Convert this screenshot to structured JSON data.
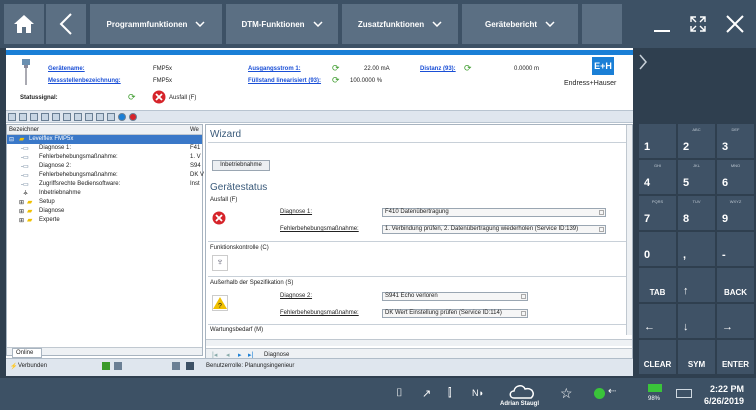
{
  "toolbar": {
    "programm": "Programmfunktionen",
    "dtm": "DTM-Funktionen",
    "zusatz": "Zusatzfunktionen",
    "bericht": "Gerätebericht"
  },
  "header": {
    "geraetename_label": "Gerätename:",
    "geraetename": "FMP5x",
    "messstelle_label": "Messstellenbezeichnung:",
    "messstelle": "FMP5x",
    "statussignal_label": "Statussignal:",
    "statussignal": "Ausfall (F)",
    "ausgangsstrom_label": "Ausgangsstrom 1:",
    "ausgangsstrom": "22.00 mA",
    "fuellstand_label": "Füllstand linearisiert (93):",
    "fuellstand": "100.0000 %",
    "distanz_label": "Distanz (93):",
    "distanz": "0.0000 m",
    "brand": "Endress+Hauser",
    "logo": "E+H"
  },
  "tree": {
    "col1": "Bezeichner",
    "col2": "We",
    "items": [
      {
        "label": "Levelflex FMP5x",
        "val": ""
      },
      {
        "label": "Diagnose 1:",
        "val": "F41"
      },
      {
        "label": "Fehlerbehebungsmaßnahme:",
        "val": "1. V"
      },
      {
        "label": "Diagnose 2:",
        "val": "S94"
      },
      {
        "label": "Fehlerbehebungsmaßnahme:",
        "val": "DK V"
      },
      {
        "label": "Zugriffsrechte Bediensoftware:",
        "val": "Inst"
      },
      {
        "label": "Inbetriebnahme",
        "val": ""
      },
      {
        "label": "Setup",
        "val": ""
      },
      {
        "label": "Diagnose",
        "val": ""
      },
      {
        "label": "Experte",
        "val": ""
      }
    ]
  },
  "wizard": {
    "title": "Wizard",
    "button": "Inbetriebnahme"
  },
  "status": {
    "title": "Gerätestatus",
    "ausfall": "Ausfall (F)",
    "diag1_label": "Diagnose 1:",
    "diag1": "F410 Datenübertragung",
    "fix1_label": "Fehlerbehebungsmaßnahme:",
    "fix1": "1. Verbindung prüfen, 2. Datenübertragung wiederholen (Service ID:139)",
    "funktion": "Funktionskontrolle (C)",
    "spez": "Außerhalb der Spezifikation (S)",
    "diag2_label": "Diagnose 2:",
    "diag2": "S941 Echo verloren",
    "fix2_label": "Fehlerbehebungsmaßnahme:",
    "fix2": "DK Wert Einstellung prüfen (Service ID:114)",
    "wartung": "Wartungsbedarf (M)"
  },
  "nav": {
    "tab": "Diagnose"
  },
  "footer": {
    "online": "Online",
    "verbunden": "Verbunden",
    "rolle": "Benutzerrolle: Planungsingenieur"
  },
  "keypad": [
    {
      "t": "",
      "m": "1"
    },
    {
      "t": "ABC",
      "m": "2"
    },
    {
      "t": "DEF",
      "m": "3"
    },
    {
      "t": "GHI",
      "m": "4"
    },
    {
      "t": "JKL",
      "m": "5"
    },
    {
      "t": "MNO",
      "m": "6"
    },
    {
      "t": "PQRS",
      "m": "7"
    },
    {
      "t": "TUV",
      "m": "8"
    },
    {
      "t": "WXYZ",
      "m": "9"
    },
    {
      "t": "",
      "m": "0"
    },
    {
      "t": "",
      "m": ","
    },
    {
      "t": "",
      "m": "-"
    },
    {
      "t": "",
      "m": "TAB"
    },
    {
      "t": "",
      "m": "↑"
    },
    {
      "t": "",
      "m": "BACK"
    },
    {
      "t": "",
      "m": "←"
    },
    {
      "t": "",
      "m": "↓"
    },
    {
      "t": "",
      "m": "→"
    },
    {
      "t": "",
      "m": "CLEAR"
    },
    {
      "t": "",
      "m": "SYM"
    },
    {
      "t": "",
      "m": "ENTER"
    }
  ],
  "taskbar": {
    "user": "Adrian Staugl",
    "battery": "98%",
    "time": "2:22 PM",
    "date": "6/26/2019"
  },
  "colors": {
    "accent": "#1a7fd6",
    "error": "#d6242a",
    "ok": "#3a9a2a",
    "warn": "#f0c000"
  }
}
